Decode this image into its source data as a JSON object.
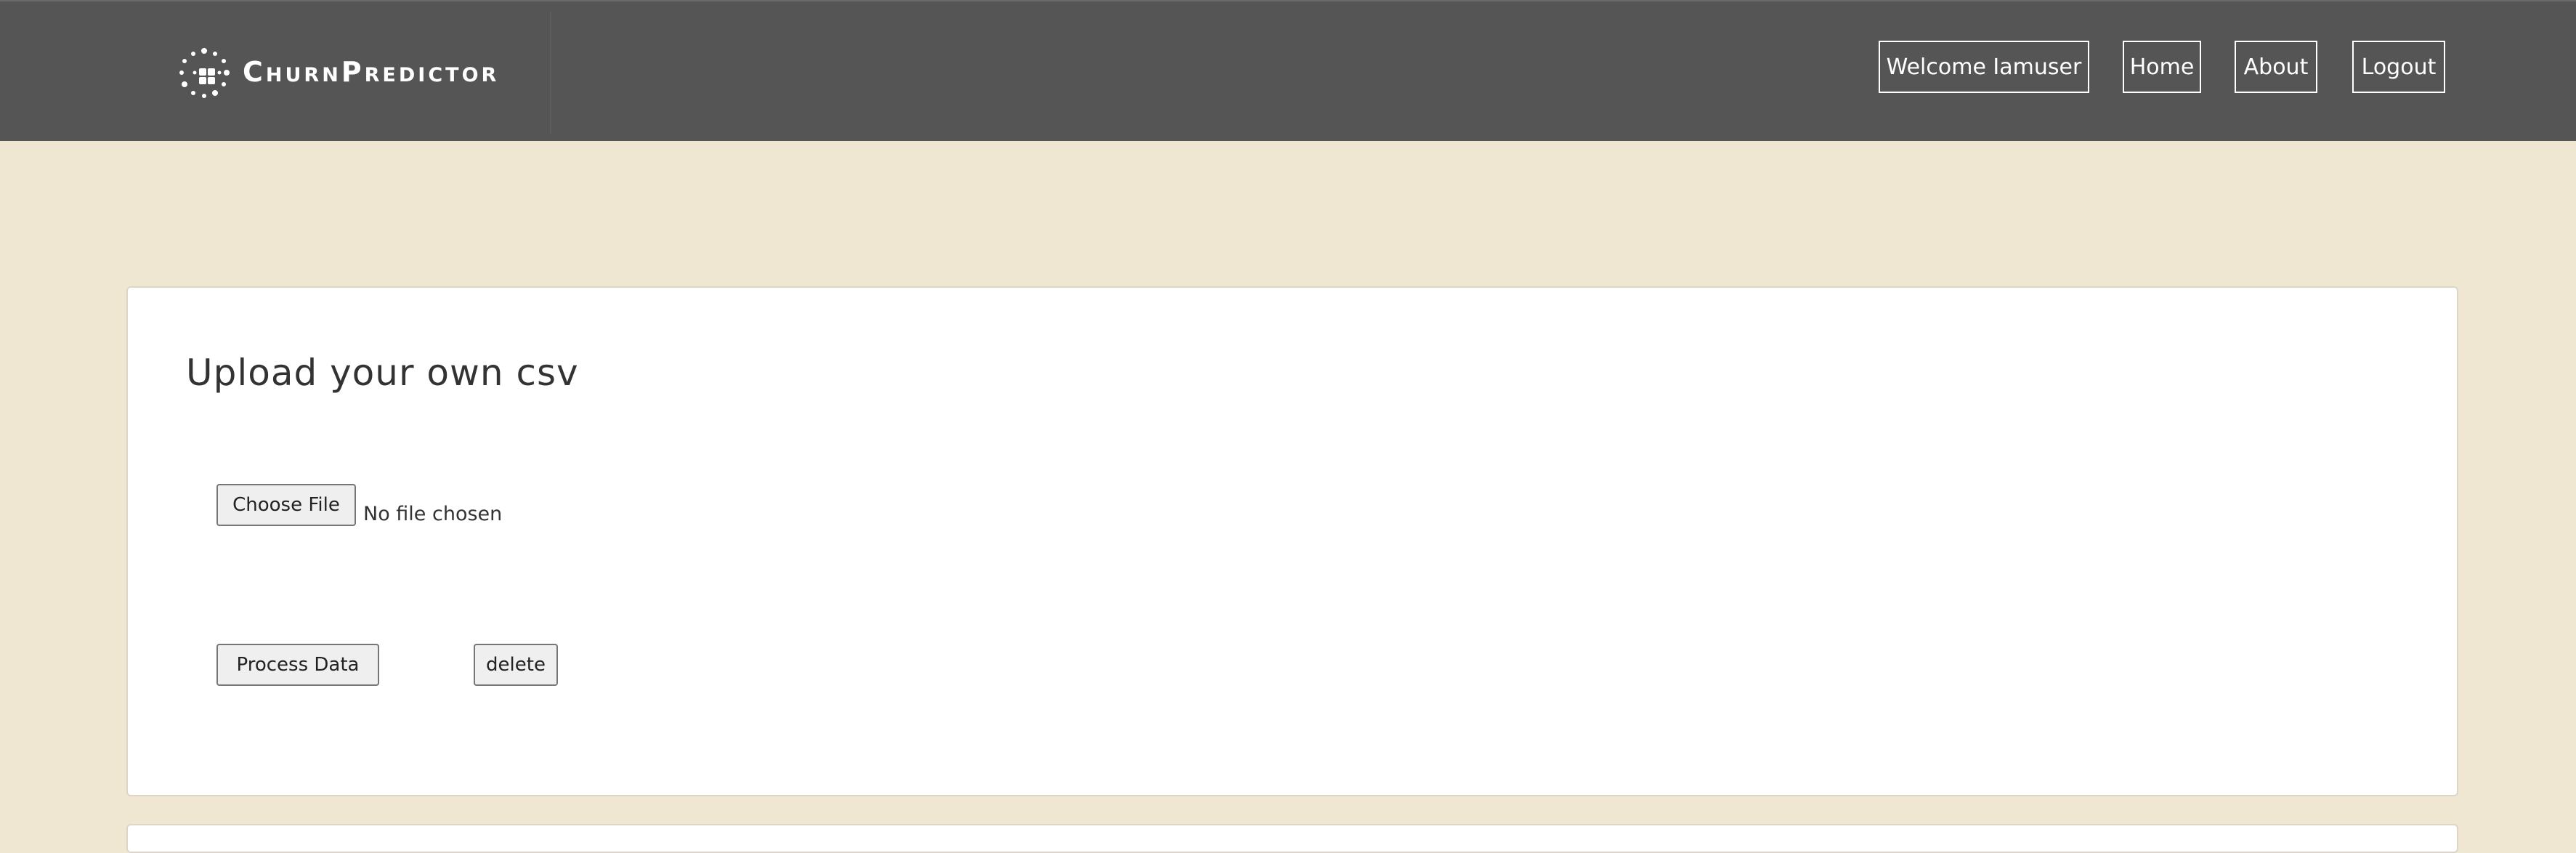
{
  "header": {
    "brand": "ChurnPredictor",
    "brand_icon": "dotted-circle-logo-icon",
    "nav": {
      "welcome": "Welcome Iamuser",
      "home": "Home",
      "about": "About",
      "logout": "Logout"
    }
  },
  "upload": {
    "title": "Upload your own csv",
    "choose_file_label": "Choose File",
    "file_status": "No file chosen",
    "process_label": "Process Data",
    "delete_label": "delete"
  },
  "colors": {
    "navbar": "#555555",
    "page_background": "#f0e7d3",
    "card": "#ffffff"
  }
}
